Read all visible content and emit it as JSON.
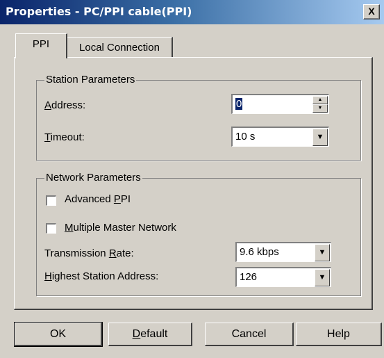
{
  "window": {
    "title": "Properties - PC/PPI cable(PPI)",
    "close_label": "X"
  },
  "tabs": [
    {
      "label": "PPI",
      "active": true
    },
    {
      "label": "Local Connection",
      "active": false
    }
  ],
  "station": {
    "legend": "Station Parameters",
    "address_label": "Address:",
    "address_value": "0",
    "timeout_label": "Timeout:",
    "timeout_value": "10 s"
  },
  "network": {
    "legend": "Network Parameters",
    "advanced_ppi_label": "Advanced PPI",
    "advanced_ppi_checked": false,
    "multi_master_label": "Multiple Master Network",
    "multi_master_checked": false,
    "rate_label": "Transmission Rate:",
    "rate_value": "9.6 kbps",
    "highest_label": "Highest Station Address:",
    "highest_value": "126"
  },
  "buttons": {
    "ok": "OK",
    "default": "Default",
    "cancel": "Cancel",
    "help": "Help"
  },
  "icons": {
    "close": "close-icon",
    "spin_up": "spin-up-icon",
    "spin_down": "spin-down-icon",
    "dropdown": "dropdown-arrow-icon"
  }
}
